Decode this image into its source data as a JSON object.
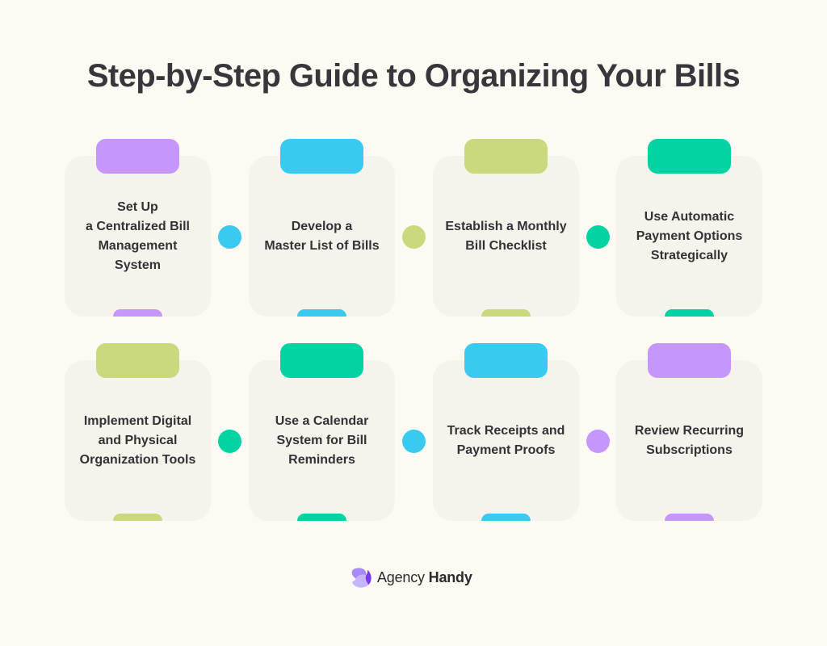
{
  "title": "Step-by-Step Guide to Organizing Your Bills",
  "colors": {
    "background": "#fdfaf4",
    "card": "#f6f3ec",
    "text": "#333236",
    "purple": "#c596fb",
    "blue": "#3acaf0",
    "green": "#cad97d",
    "teal": "#02d3a2"
  },
  "steps": [
    {
      "label": "Set Up\na Centralized Bill\nManagement\nSystem",
      "accent": "#c596fb",
      "connector_color": "#3acaf0"
    },
    {
      "label": "Develop a\nMaster List of Bills",
      "accent": "#3acaf0",
      "connector_color": "#cad97d"
    },
    {
      "label": "Establish a Monthly\nBill Checklist",
      "accent": "#cad97d",
      "connector_color": "#02d3a2"
    },
    {
      "label": "Use Automatic\nPayment Options\nStrategically",
      "accent": "#02d3a2",
      "connector_color": null
    },
    {
      "label": "Implement Digital\nand Physical\nOrganization Tools",
      "accent": "#cad97d",
      "connector_color": "#02d3a2"
    },
    {
      "label": "Use a Calendar\nSystem for Bill\nReminders",
      "accent": "#02d3a2",
      "connector_color": "#3acaf0"
    },
    {
      "label": "Track Receipts and\nPayment Proofs",
      "accent": "#3acaf0",
      "connector_color": "#c596fb"
    },
    {
      "label": "Review Recurring\nSubscriptions",
      "accent": "#c596fb",
      "connector_color": null
    }
  ],
  "brand": {
    "name_light": "Agency",
    "name_bold": "Handy",
    "logo_icon": "agency-handy-logo-icon",
    "logo_colors": [
      "#a78bfa",
      "#7c3aed",
      "#c4b5fd"
    ]
  }
}
